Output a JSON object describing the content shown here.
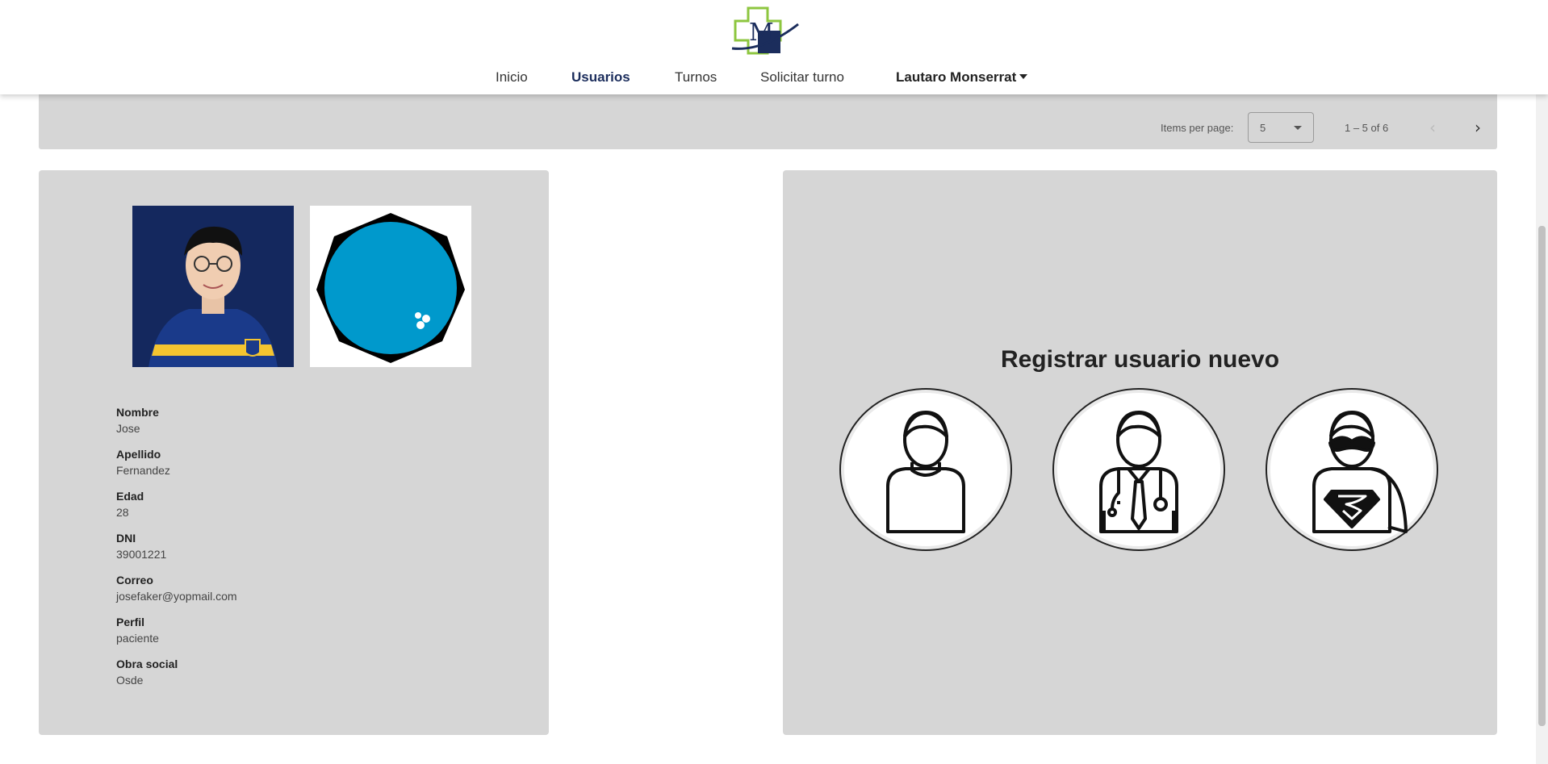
{
  "nav": {
    "items": [
      "Inicio",
      "Usuarios",
      "Turnos",
      "Solicitar turno"
    ],
    "active": "Usuarios",
    "user_menu": "Lautaro Monserrat"
  },
  "logo": {
    "letter": "M",
    "colors": {
      "cross": "#8dc63f",
      "navy": "#1b2d5c"
    }
  },
  "paginator": {
    "items_per_page_label": "Items per page:",
    "items_per_page_value": "5",
    "range_label": "1 – 5 of 6"
  },
  "detail": {
    "fields": [
      {
        "label": "Nombre",
        "value": "Jose"
      },
      {
        "label": "Apellido",
        "value": "Fernandez"
      },
      {
        "label": "Edad",
        "value": "28"
      },
      {
        "label": "DNI",
        "value": "39001221"
      },
      {
        "label": "Correo",
        "value": "josefaker@yopmail.com"
      },
      {
        "label": "Perfil",
        "value": "paciente"
      },
      {
        "label": "Obra social",
        "value": "Osde"
      }
    ]
  },
  "register": {
    "title": "Registrar usuario nuevo",
    "roles": [
      "patient-icon",
      "doctor-icon",
      "admin-superhero-icon"
    ]
  },
  "colors": {
    "panel": "#d6d6d6",
    "accent_blue": "#0099cc",
    "navy": "#1b2d5c"
  }
}
